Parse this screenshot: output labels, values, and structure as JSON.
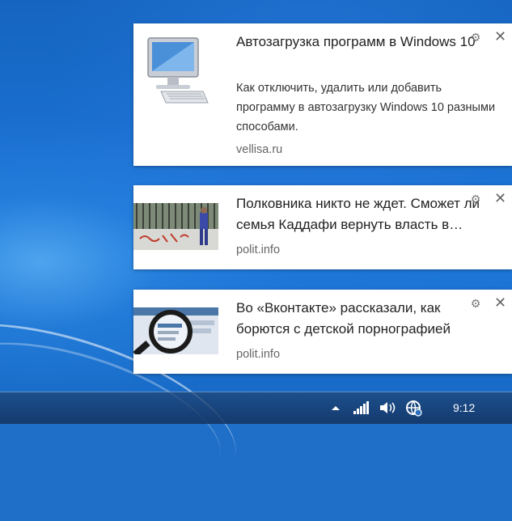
{
  "notifications": [
    {
      "title": "Автозагрузка программ в Windows 10",
      "body": "Как отключить, удалить или добавить программу в автозагрузку Windows 10 разными способами.",
      "source": "vellisa.ru",
      "image": "computer-icon"
    },
    {
      "title": "Полковника никто не ждет. Сможет ли семья Каддафи вернуть власть в…",
      "source": "polit.info",
      "image": "street-wall-photo"
    },
    {
      "title": "Во «Вконтакте» рассказали, как борются с детской порнографией",
      "source": "polit.info",
      "image": "magnifier-photo"
    }
  ],
  "taskbar": {
    "clock": "9:12",
    "tray_icons": [
      "chevron-up-icon",
      "signal-icon",
      "volume-icon",
      "network-icon"
    ]
  },
  "colors": {
    "desktop": "#1f6fc8",
    "toast_bg": "#ffffff",
    "source_text": "#666666"
  }
}
